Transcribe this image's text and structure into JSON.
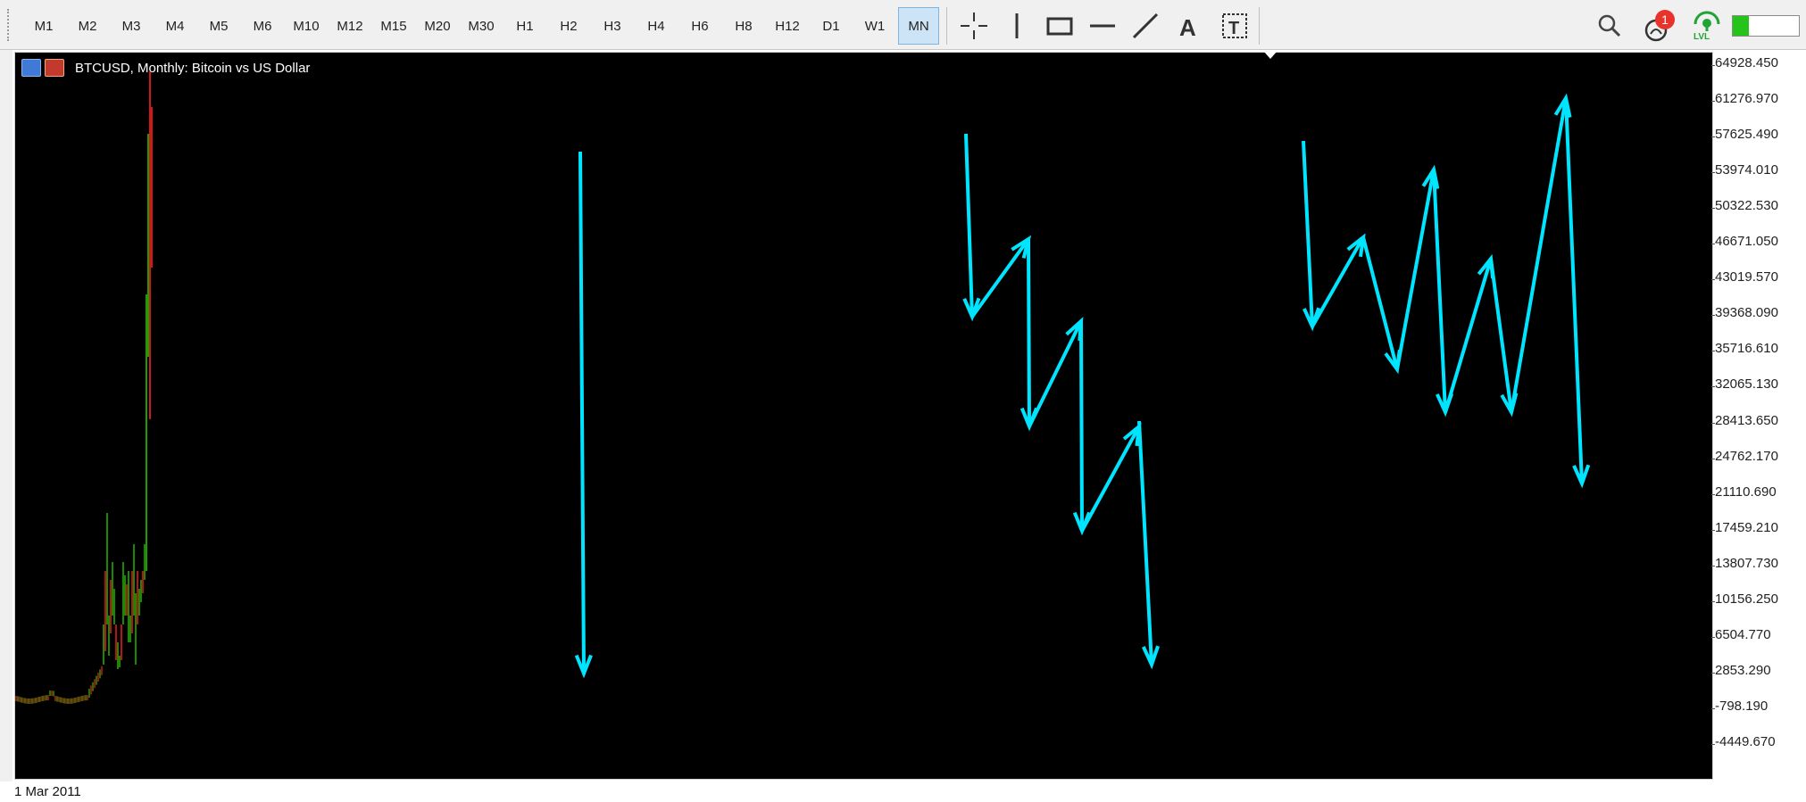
{
  "toolbar": {
    "timeframes": [
      "M1",
      "M2",
      "M3",
      "M4",
      "M5",
      "M6",
      "M10",
      "M12",
      "M15",
      "M20",
      "M30",
      "H1",
      "H2",
      "H3",
      "H4",
      "H6",
      "H8",
      "H12",
      "D1",
      "W1",
      "MN"
    ],
    "active_timeframe": "MN",
    "notification_count": "1",
    "lvl_label": "LVL"
  },
  "chart": {
    "title": "BTCUSD, Monthly:  Bitcoin vs US Dollar",
    "time_label": "1 Mar 2011",
    "price_labels": [
      "64928.450",
      "61276.970",
      "57625.490",
      "53974.010",
      "50322.530",
      "46671.050",
      "43019.570",
      "39368.090",
      "35716.610",
      "32065.130",
      "28413.650",
      "24762.170",
      "21110.690",
      "17459.210",
      "13807.730",
      "10156.250",
      "6504.770",
      "2853.290",
      "-798.190",
      "-4449.670"
    ],
    "colors": {
      "up_candle": "#26c400",
      "down_candle": "#ff2020",
      "arrow": "#00e5ff",
      "background": "#000000"
    }
  }
}
